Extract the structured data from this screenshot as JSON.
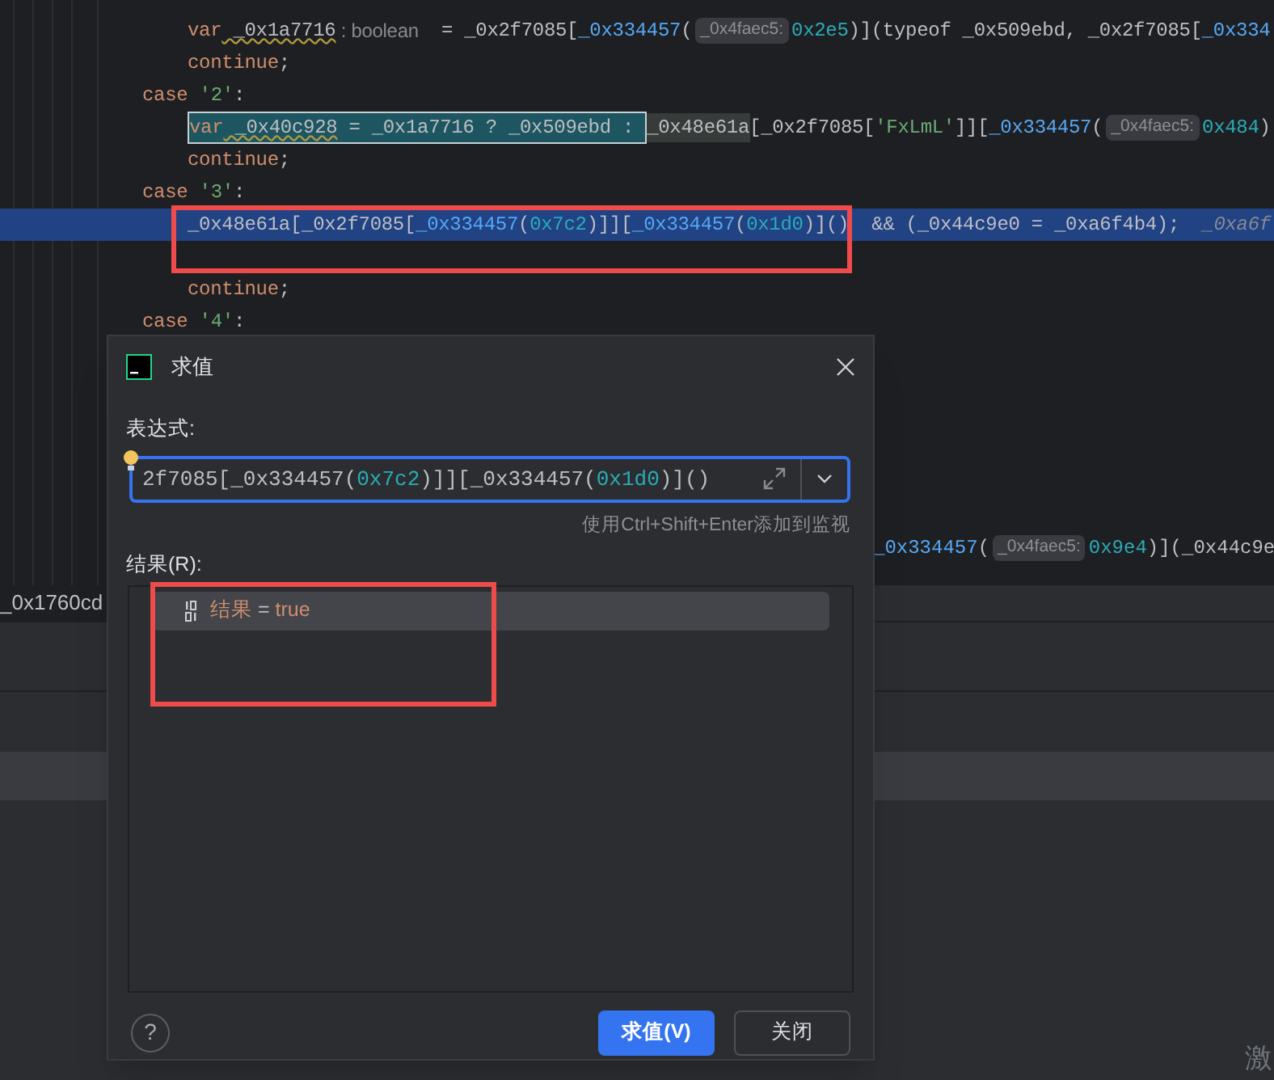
{
  "editor": {
    "lines": [
      {
        "kind": "statement",
        "current": false,
        "tokens": [
          {
            "text": "var",
            "kind": "keyword"
          },
          {
            "text": " _0x1a7716",
            "kind": "warn"
          },
          {
            "text": " : boolean",
            "kind": "typehint"
          },
          {
            "text": "  = _0x2f7085["
          },
          {
            "text": "_0x334457",
            "kind": "func"
          },
          {
            "text": "("
          },
          {
            "text": "_0x4faec5:",
            "kind": "inlay"
          },
          {
            "text": "0x2e5",
            "kind": "number"
          },
          {
            "text": ")](typeof _0x509ebd, _0x2f7085["
          },
          {
            "text": "_0x334",
            "kind": "func"
          }
        ]
      },
      {
        "kind": "statement",
        "current": false,
        "tokens": [
          {
            "text": "continue",
            "kind": "keyword"
          },
          {
            "text": ";"
          }
        ]
      },
      {
        "kind": "case",
        "current": false,
        "tokens": [
          {
            "text": "case",
            "kind": "keyword"
          },
          {
            "text": " '2'",
            "kind": "string"
          },
          {
            "text": ":"
          }
        ]
      },
      {
        "kind": "statement",
        "current": false,
        "selection": [
          {
            "text": "var",
            "kind": "keyword"
          },
          {
            "text": " _0x40c928",
            "kind": "warn"
          },
          {
            "text": " = _0x1a7716 ? _0x509ebd : "
          }
        ],
        "tokens": [
          {
            "text": "_0x48e61a",
            "kind": "occurrence"
          },
          {
            "text": "[_0x2f7085["
          },
          {
            "text": "'FxLmL'",
            "kind": "string"
          },
          {
            "text": "]]["
          },
          {
            "text": "_0x334457",
            "kind": "func"
          },
          {
            "text": "("
          },
          {
            "text": "_0x4faec5:",
            "kind": "inlay"
          },
          {
            "text": "0x484",
            "kind": "number"
          },
          {
            "text": ")"
          }
        ]
      },
      {
        "kind": "statement",
        "current": false,
        "tokens": [
          {
            "text": "continue",
            "kind": "keyword"
          },
          {
            "text": ";"
          }
        ]
      },
      {
        "kind": "case",
        "current": false,
        "tokens": [
          {
            "text": "case",
            "kind": "keyword"
          },
          {
            "text": " '3'",
            "kind": "string"
          },
          {
            "text": ":"
          }
        ]
      },
      {
        "kind": "statement",
        "current": true,
        "tokens": [
          {
            "text": "_0x48e61a[_0x2f7085["
          },
          {
            "text": "_0x334457",
            "kind": "func"
          },
          {
            "text": "("
          },
          {
            "text": "0x7c2",
            "kind": "number"
          },
          {
            "text": ")]]["
          },
          {
            "text": "_0x334457",
            "kind": "func"
          },
          {
            "text": "("
          },
          {
            "text": "0x1d0",
            "kind": "number"
          },
          {
            "text": ")]()  && (_0x44c9e0 = _0xa6f4b4);  "
          },
          {
            "text": "_0xa6f",
            "kind": "debugvalue"
          }
        ]
      },
      {
        "kind": "statement",
        "current": false
      },
      {
        "kind": "statement",
        "current": false,
        "tokens": [
          {
            "text": "continue",
            "kind": "keyword"
          },
          {
            "text": ";"
          }
        ]
      },
      {
        "kind": "case",
        "current": false,
        "tokens": [
          {
            "text": "case",
            "kind": "keyword"
          },
          {
            "text": " '4'",
            "kind": "string"
          },
          {
            "text": ":"
          }
        ]
      }
    ],
    "fragment_right": [
      {
        "text": "_0x334457",
        "kind": "func"
      },
      {
        "text": "("
      },
      {
        "text": "_0x4faec5:",
        "kind": "inlay"
      },
      {
        "text": "0x9e4",
        "kind": "number"
      },
      {
        "text": ")](_0x44c9e"
      }
    ],
    "fragment_left": "_0x1760cd"
  },
  "dialog": {
    "title": "求值",
    "expression_label": "表达式:",
    "expression": [
      {
        "text": "2f7085[_0x334457("
      },
      {
        "text": "0x7c2",
        "kind": "number"
      },
      {
        "text": ")]][_0x334457("
      },
      {
        "text": "0x1d0",
        "kind": "number"
      },
      {
        "text": ")]()"
      }
    ],
    "hint": "使用Ctrl+Shift+Enter添加到监视",
    "result_label": "结果(R):",
    "result": {
      "name": "结果",
      "equals": "=",
      "value": "true",
      "selected": true
    },
    "help": "?",
    "buttons": [
      {
        "label": "求值(V)",
        "primary": true
      },
      {
        "label": "关闭",
        "primary": false
      }
    ]
  },
  "corner_text": "激"
}
